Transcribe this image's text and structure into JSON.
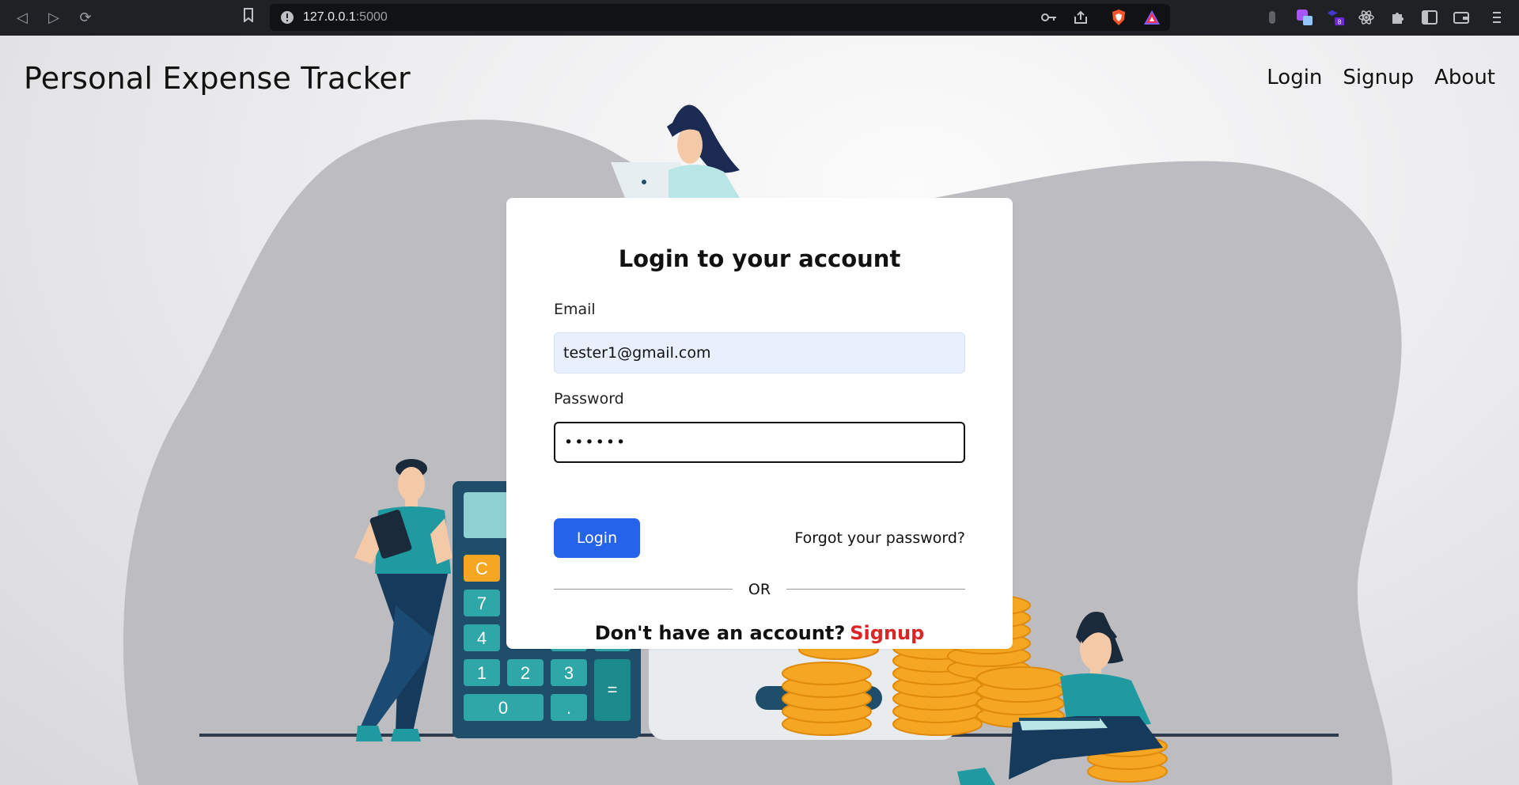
{
  "browser": {
    "url_host": "127.0.0.1",
    "url_port": ":5000",
    "extension_badge": "8"
  },
  "header": {
    "brand": "Personal Expense Tracker",
    "nav": [
      "Login",
      "Signup",
      "About"
    ]
  },
  "login_card": {
    "title": "Login to your account",
    "email_label": "Email",
    "email_value": "tester1@gmail.com",
    "password_label": "Password",
    "password_value": "••••••",
    "login_button": "Login",
    "forgot_link": "Forgot your password?",
    "divider_text": "OR",
    "no_account_text": "Don't have an account?",
    "signup_link": "Signup"
  },
  "calculator_keys": [
    "C",
    "7",
    "4",
    "1",
    "2",
    "3",
    "0",
    ".",
    "="
  ],
  "colors": {
    "primary_button": "#2563eb",
    "signup_link": "#dc2626",
    "email_fill": "#e8f0fe",
    "teal": "#1e9aa0",
    "navy": "#1b3a5c",
    "coin": "#f5a623"
  }
}
